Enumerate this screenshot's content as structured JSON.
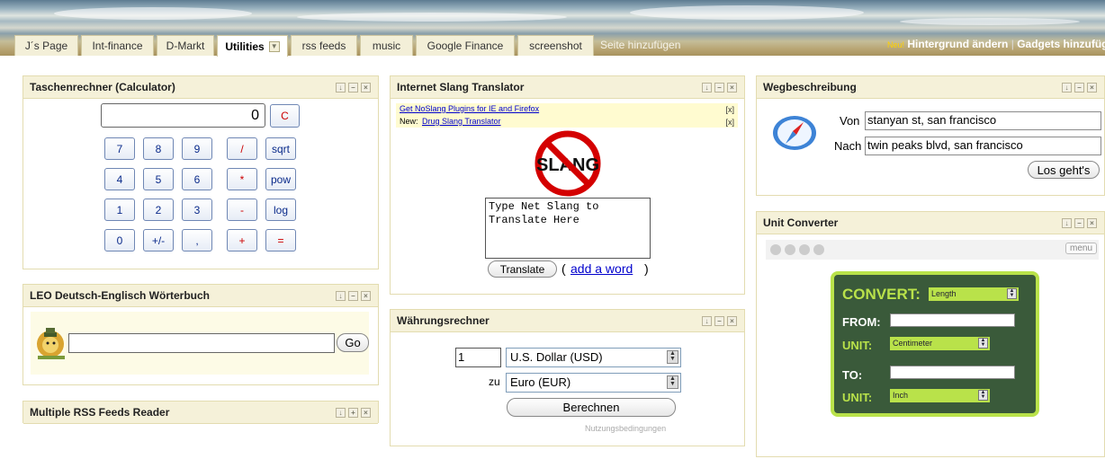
{
  "tabs": [
    {
      "label": "J´s Page"
    },
    {
      "label": "Int-finance"
    },
    {
      "label": "D-Markt"
    },
    {
      "label": "Utilities"
    },
    {
      "label": "rss feeds"
    },
    {
      "label": "music"
    },
    {
      "label": "Google Finance"
    },
    {
      "label": "screenshot"
    }
  ],
  "add_tab": "Seite hinzufügen",
  "topbar": {
    "new_badge": "Neu!",
    "change_bg": "Hintergrund ändern",
    "separator": "|",
    "add_gadgets": "Gadgets hinzufüg"
  },
  "calculator": {
    "title": "Taschenrechner (Calculator)",
    "display": "0",
    "clear": "C",
    "rows": [
      [
        "7",
        "8",
        "9",
        "/",
        "sqrt"
      ],
      [
        "4",
        "5",
        "6",
        "*",
        "pow"
      ],
      [
        "1",
        "2",
        "3",
        "-",
        "log"
      ],
      [
        "0",
        "+/-",
        ",",
        "+",
        "="
      ]
    ]
  },
  "leo": {
    "title": "LEO Deutsch-Englisch Wörterbuch",
    "go": "Go",
    "input_value": ""
  },
  "rss": {
    "title": "Multiple RSS Feeds Reader"
  },
  "slang": {
    "title": "Internet Slang Translator",
    "link1": "Get NoSlang Plugins for IE and Firefox",
    "new_label": "New:",
    "link2": "Drug Slang Translator",
    "close": "[x]",
    "logo_text": "SLANG",
    "textarea": "Type Net Slang to Translate Here",
    "translate": "Translate",
    "add_open": "(",
    "add_word": "add a word",
    "add_close": ")"
  },
  "currency": {
    "title": "Währungsrechner",
    "amount": "1",
    "from": "U.S. Dollar (USD)",
    "zu": "zu",
    "to": "Euro (EUR)",
    "calc": "Berechnen",
    "terms": "Nutzungsbedingungen"
  },
  "directions": {
    "title": "Wegbeschreibung",
    "von_label": "Von",
    "von": "stanyan st, san francisco",
    "nach_label": "Nach",
    "nach": "twin peaks blvd, san francisco",
    "go": "Los geht's"
  },
  "unit": {
    "title": "Unit Converter",
    "menu": "menu",
    "convert": "CONVERT:",
    "convert_value": "Length",
    "from": "FROM:",
    "unit1_label": "UNIT:",
    "unit1": "Centimeter",
    "to": "TO:",
    "unit2_label": "UNIT:",
    "unit2": "Inch"
  },
  "colors": {
    "header_bg": "#f5f1d9",
    "accent_green": "#b9e24a",
    "link": "#0000cc"
  },
  "ctl_icons": {
    "move": "↓",
    "min": "–",
    "close": "×",
    "plus": "+"
  }
}
